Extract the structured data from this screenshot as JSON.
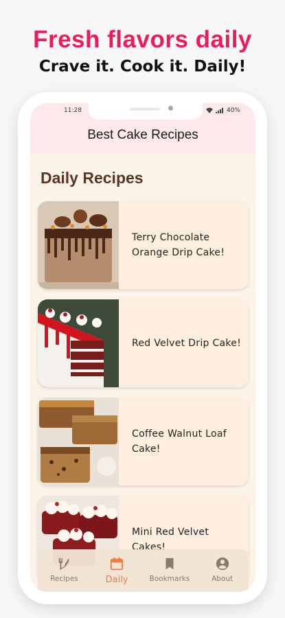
{
  "promo": {
    "headline": "Fresh flavors daily",
    "subline": "Crave it. Cook it. Daily!"
  },
  "status_bar": {
    "time": "11:28",
    "battery": "40%"
  },
  "app": {
    "title": "Best Cake Recipes",
    "section_title": "Daily Recipes"
  },
  "recipes": [
    {
      "title": "Terry Chocolate Orange Drip Cake!"
    },
    {
      "title": "Red Velvet Drip Cake!"
    },
    {
      "title": "Coffee Walnut Loaf Cake!"
    },
    {
      "title": "Mini Red Velvet Cakes!"
    }
  ],
  "nav": [
    {
      "label": "Recipes",
      "icon": "fork-knife-icon",
      "active": false
    },
    {
      "label": "Daily",
      "icon": "calendar-icon",
      "active": true
    },
    {
      "label": "Bookmarks",
      "icon": "bookmark-icon",
      "active": false
    },
    {
      "label": "About",
      "icon": "account-icon",
      "active": false
    }
  ],
  "colors": {
    "headline": "#ee1b5a",
    "topbar": "#fde9ea",
    "background": "#fdf4e9",
    "card": "#fdeedd",
    "section_title": "#5a3522",
    "nav_active": "#f07a45",
    "nav_inactive": "#8a7a6b"
  }
}
